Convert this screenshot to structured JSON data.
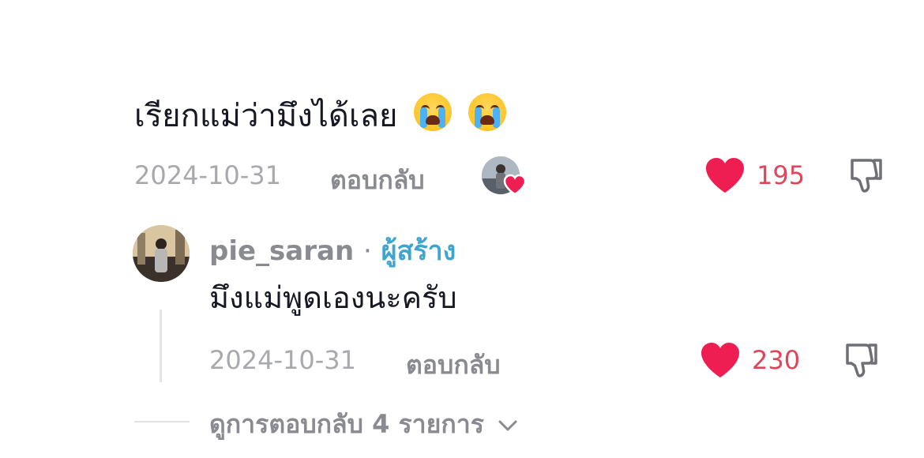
{
  "comment": {
    "text": "เรียกแม่ว่ามึงได้เลย",
    "emojis": [
      "crying-face-emoji",
      "crying-face-emoji"
    ],
    "date": "2024-10-31",
    "reply_label": "ตอบกลับ",
    "likes": "195",
    "creator_liked": true
  },
  "reply": {
    "username": "pie_saran",
    "separator": "·",
    "creator_label": "ผู้สร้าง",
    "text": "มึงแม่พูดเองนะครับ",
    "date": "2024-10-31",
    "reply_label": "ตอบกลับ",
    "likes": "230"
  },
  "view_replies": {
    "label": "ดูการตอบกลับ 4 รายการ"
  },
  "colors": {
    "heart": "#ee1d52",
    "like_count": "#e0455a",
    "creator": "#3ea6ce",
    "meta": "#a7a9ad"
  }
}
